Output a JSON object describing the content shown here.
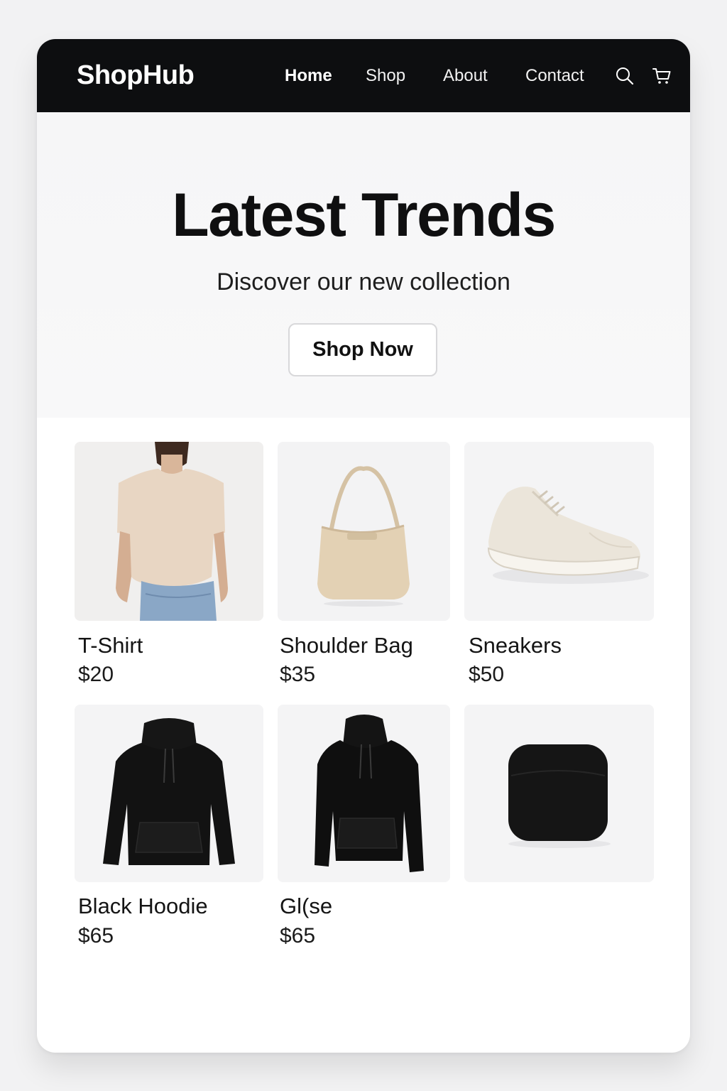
{
  "brand": "ShopHub",
  "nav": {
    "links": [
      "Home",
      "Shop",
      "About",
      "Contact"
    ],
    "active": "Home",
    "icons": [
      "search-icon",
      "cart-icon"
    ]
  },
  "hero": {
    "title": "Latest Trends",
    "subtitle": "Discover our new collection",
    "button_label": "Shop Now"
  },
  "products": [
    {
      "name": "T-Shirt",
      "price": "$20",
      "image": "t-shirt"
    },
    {
      "name": "Shoulder Bag",
      "price": "$35",
      "image": "shoulder-bag"
    },
    {
      "name": "Sneakers",
      "price": "$50",
      "image": "sneakers"
    },
    {
      "name": "Black Hoodie",
      "price": "$65",
      "image": "black-hoodie"
    },
    {
      "name": "Gl(se",
      "price": "$65",
      "image": "black-hoodie"
    },
    {
      "name": "",
      "price": "",
      "image": "black-case"
    }
  ],
  "colors": {
    "navbar": "#0d0e10",
    "hero_bg": "#f6f6f7",
    "card_bg": "#f4f4f5"
  }
}
